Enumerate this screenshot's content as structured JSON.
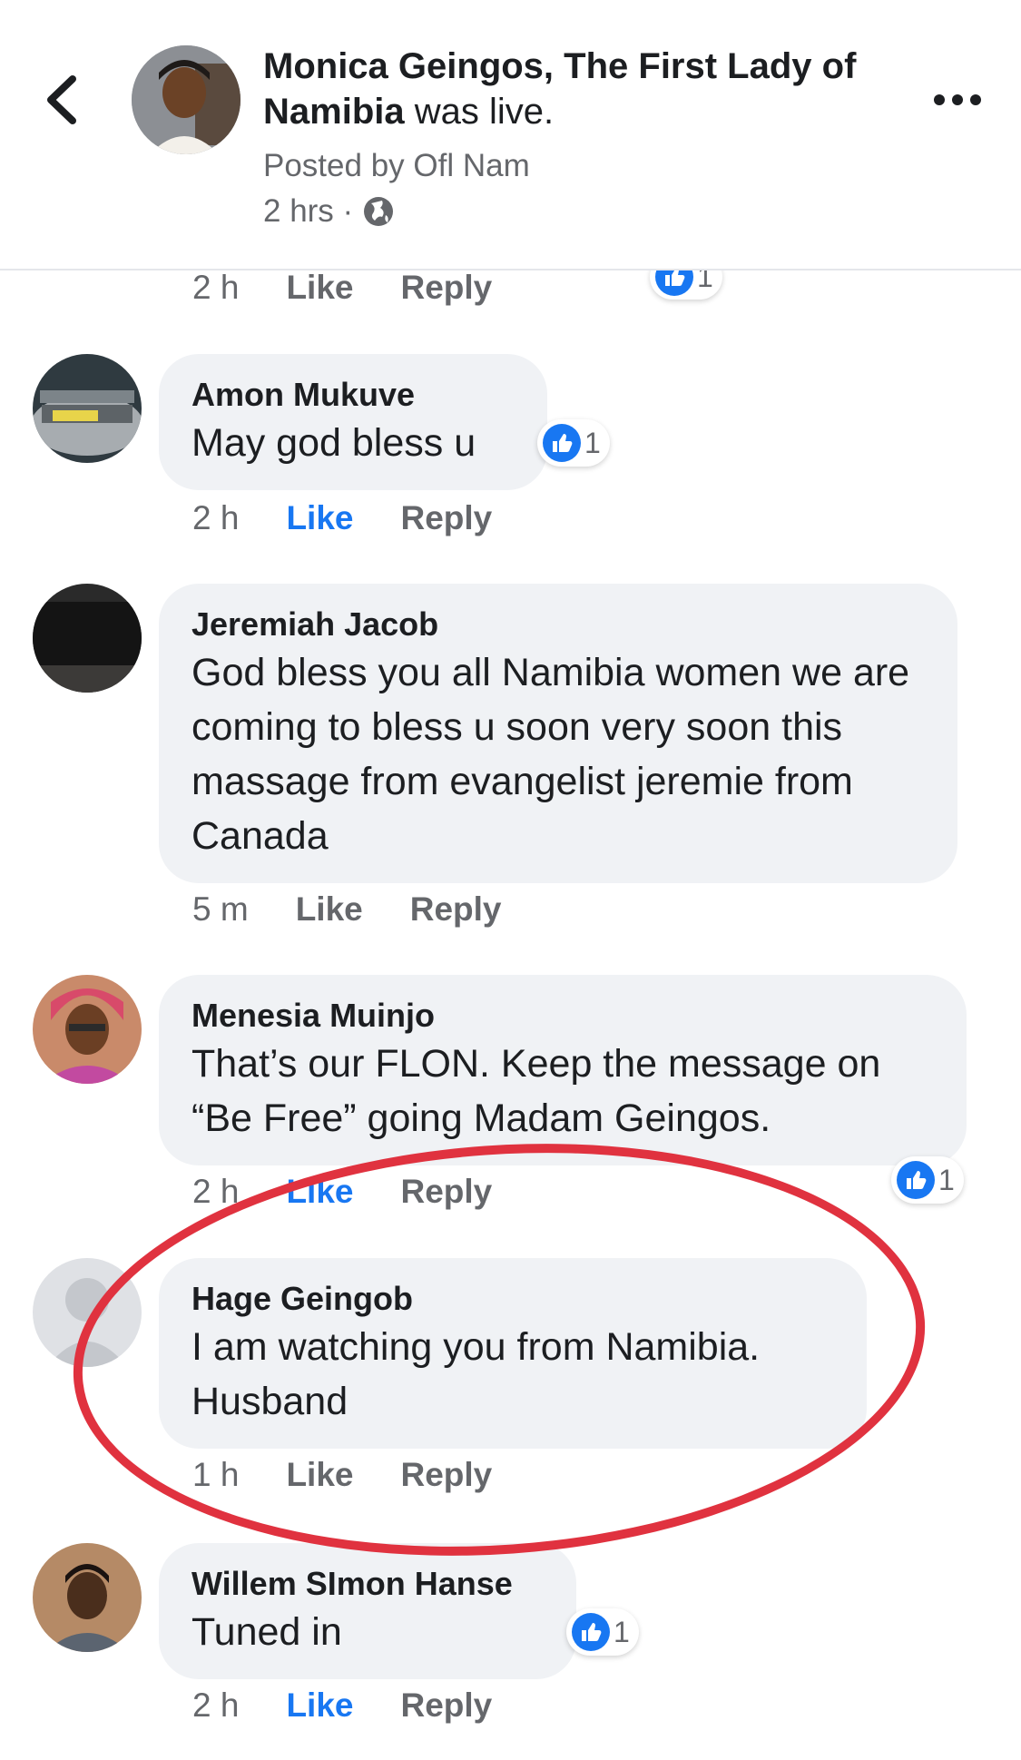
{
  "header": {
    "name": "Monica Geingos, The First Lady of Namibia",
    "suffix": " was live.",
    "posted_by": "Posted by Ofl Nam",
    "time": "2 hrs ·"
  },
  "top_partial": {
    "time": "2 h",
    "like": "Like",
    "reply": "Reply",
    "reaction_count": "1"
  },
  "comments": [
    {
      "name": "Amon Mukuve",
      "text": "May god bless u",
      "time": "2 h",
      "like": "Like",
      "reply": "Reply",
      "reaction_count": "1",
      "liked": true
    },
    {
      "name": "Jeremiah Jacob",
      "text": "God bless you all Namibia women we are coming to bless u soon very soon this massage from evangelist jeremie from Canada",
      "time": "5 m",
      "like": "Like",
      "reply": "Reply",
      "liked": false
    },
    {
      "name": "Menesia Muinjo",
      "text": "That’s our FLON. Keep the message on “Be Free”  going  Madam Geingos.",
      "time": "2 h",
      "like": "Like",
      "reply": "Reply",
      "reaction_count": "1",
      "liked": true
    },
    {
      "name": "Hage Geingob",
      "text": "I am watching you from Namibia. Husband",
      "time": "1 h",
      "like": "Like",
      "reply": "Reply",
      "liked": false
    },
    {
      "name": "Willem SImon Hanse",
      "text": "Tuned in",
      "time": "2 h",
      "like": "Like",
      "reply": "Reply",
      "reaction_count": "1",
      "liked": true
    }
  ],
  "colors": {
    "accent": "#1877f2",
    "highlight_circle": "#e0323f",
    "bubble": "#f0f2f5"
  },
  "icons": [
    "chevron-left-icon",
    "more-icon",
    "globe-icon",
    "thumbs-up-icon"
  ]
}
